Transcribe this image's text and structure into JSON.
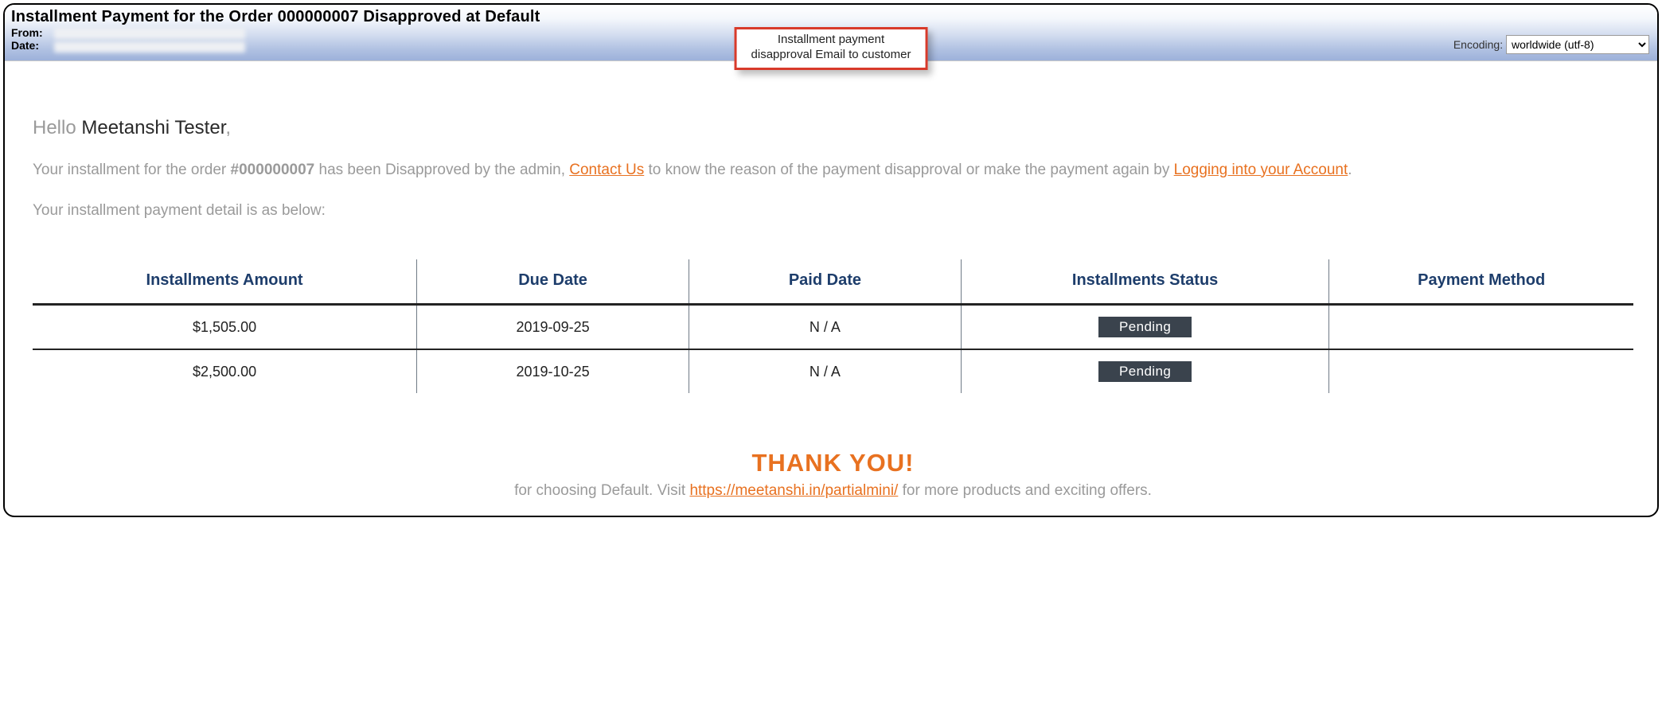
{
  "header": {
    "title": "Installment Payment for the Order 000000007 Disapproved at Default",
    "from_label": "From:",
    "date_label": "Date:",
    "encoding_label": "Encoding:",
    "encoding_value": "worldwide (utf-8)"
  },
  "callout": {
    "line1": "Installment payment",
    "line2": "disapproval Email to customer"
  },
  "body": {
    "hello": "Hello ",
    "customer_name": "Meetanshi Tester",
    "comma": ",",
    "p1_a": "Your installment for the order ",
    "order_no": "#000000007",
    "p1_b": " has been Disapproved by the admin, ",
    "contact_us": "Contact Us",
    "p1_c": " to know the reason of the payment disapproval or make the payment again by ",
    "login_link": "Logging into your Account",
    "period": ".",
    "detail_intro": "Your installment payment detail is as below:"
  },
  "table": {
    "headers": {
      "amount": "Installments Amount",
      "due": "Due Date",
      "paid": "Paid Date",
      "status": "Installments Status",
      "method": "Payment Method"
    },
    "rows": [
      {
        "amount": "$1,505.00",
        "due": "2019-09-25",
        "paid": "N / A",
        "status": "Pending",
        "method": ""
      },
      {
        "amount": "$2,500.00",
        "due": "2019-10-25",
        "paid": "N / A",
        "status": "Pending",
        "method": ""
      }
    ]
  },
  "footer": {
    "thanks": "THANK YOU!",
    "line_a": "for choosing Default. Visit ",
    "url_text": "https://meetanshi.in/partialmini/",
    "line_b": " for more products and exciting offers."
  }
}
